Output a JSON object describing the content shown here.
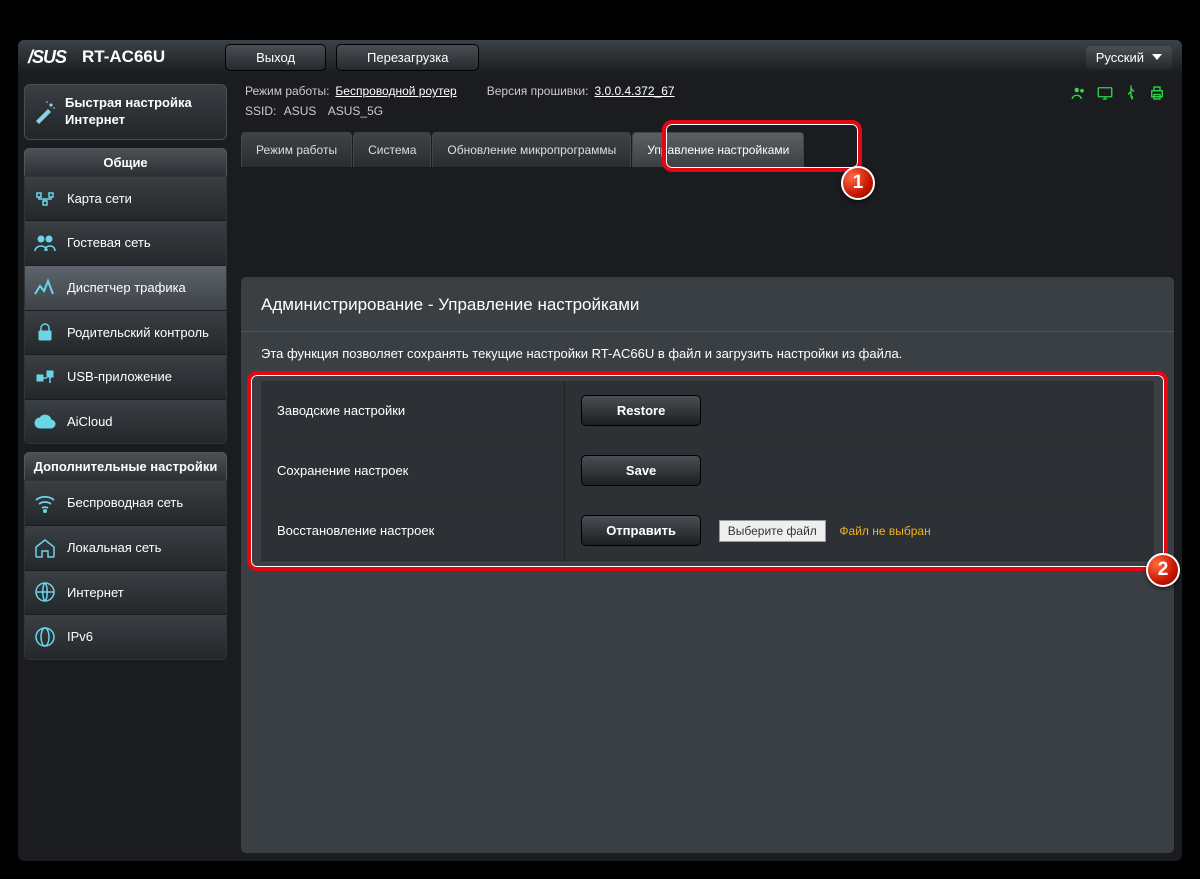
{
  "header": {
    "brand": "/SUS",
    "model": "RT-AC66U",
    "logout": "Выход",
    "reboot": "Перезагрузка",
    "language": "Русский"
  },
  "quick_setup": "Быстрая настройка Интернет",
  "info": {
    "mode_label": "Режим работы:",
    "mode_value": "Беспроводной роутер",
    "fw_label": "Версия прошивки:",
    "fw_value": "3.0.0.4.372_67",
    "ssid_label": "SSID:",
    "ssid1": "ASUS",
    "ssid2": "ASUS_5G"
  },
  "sections": {
    "general": "Общие",
    "advanced": "Дополнительные настройки"
  },
  "nav_general": [
    {
      "label": "Карта сети",
      "icon": "network"
    },
    {
      "label": "Гостевая сеть",
      "icon": "guests"
    },
    {
      "label": "Диспетчер трафика",
      "icon": "traffic"
    },
    {
      "label": "Родительский контроль",
      "icon": "lock"
    },
    {
      "label": "USB-приложение",
      "icon": "usb"
    },
    {
      "label": "AiCloud",
      "icon": "cloud"
    }
  ],
  "nav_advanced": [
    {
      "label": "Беспроводная сеть",
      "icon": "wifi"
    },
    {
      "label": "Локальная сеть",
      "icon": "home"
    },
    {
      "label": "Интернет",
      "icon": "globe"
    },
    {
      "label": "IPv6",
      "icon": "ipv6"
    }
  ],
  "tabs": [
    "Режим работы",
    "Система",
    "Обновление микропрограммы",
    "Управление настройками"
  ],
  "content": {
    "title": "Администрирование - Управление настройками",
    "desc": "Эта функция позволяет сохранять текущие настройки RT-AC66U в файл и загрузить настройки из файла.",
    "row1_label": "Заводские настройки",
    "row1_btn": "Restore",
    "row2_label": "Сохранение настроек",
    "row2_btn": "Save",
    "row3_label": "Восстановление настроек",
    "row3_btn": "Отправить",
    "file_btn": "Выберите файл",
    "file_status": "Файл не выбран"
  },
  "badges": {
    "1": "1",
    "2": "2"
  }
}
